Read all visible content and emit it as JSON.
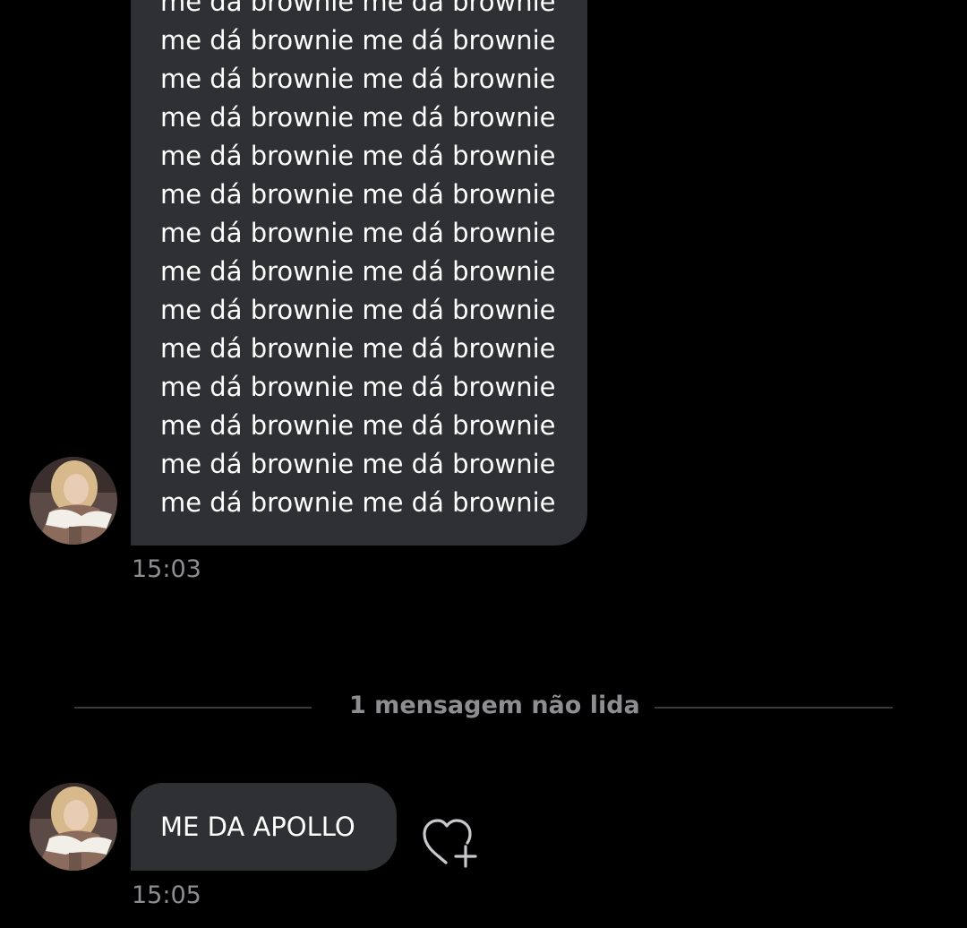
{
  "messages": [
    {
      "sender_avatar": "user-avatar",
      "lines": [
        "me dá brownie me dá brownie",
        "me dá brownie me dá brownie",
        "me dá brownie me dá brownie",
        "me dá brownie me dá brownie",
        "me dá brownie me dá brownie",
        "me dá brownie me dá brownie",
        "me dá brownie me dá brownie",
        "me dá brownie me dá brownie",
        "me dá brownie me dá brownie",
        "me dá brownie me dá brownie",
        "me dá brownie me dá brownie",
        "me dá brownie me dá brownie",
        "me dá brownie me dá brownie",
        "me dá brownie me dá brownie"
      ],
      "time": "15:03"
    },
    {
      "sender_avatar": "user-avatar",
      "text": "ME DA APOLLO",
      "time": "15:05"
    }
  ],
  "unread_divider": {
    "label": "1 mensagem não lida"
  },
  "icons": {
    "like": "heart-plus-icon"
  },
  "colors": {
    "background": "#000000",
    "bubble": "#2f3033",
    "meta_text": "#8e8e92"
  }
}
